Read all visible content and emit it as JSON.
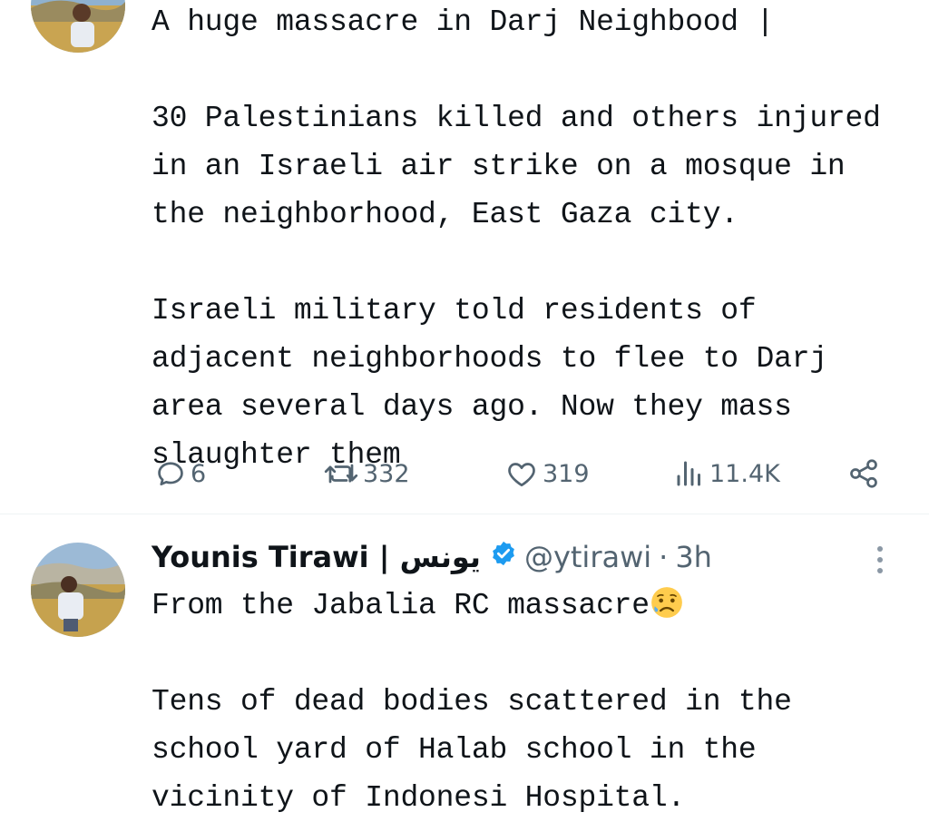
{
  "tweet1": {
    "text": "A huge massacre in Darj Neighbood |\n\n30 Palestinians killed and others injured in an Israeli air strike on a mosque in the neighborhood, East Gaza city.\n\nIsraeli military told residents of adjacent neighborhoods to flee to Darj area several days ago. Now they mass slaughter them",
    "actions": {
      "replies": "6",
      "reposts": "332",
      "likes": "319",
      "views": "11.4K"
    },
    "icons": [
      "reply-icon",
      "repost-icon",
      "like-icon",
      "views-icon",
      "share-icon"
    ]
  },
  "tweet2": {
    "display_name": "Younis Tirawi | يونس",
    "handle": "@ytirawi",
    "separator": "·",
    "time": "3h",
    "text_line1": "From the Jabalia RC massacre",
    "text_rest": "\n\nTens of dead bodies scattered in the school yard of Halab school in the vicinity of Indonesi Hospital.",
    "emoji": "sad-but-relieved-face",
    "verified": true
  },
  "colors": {
    "text": "#0f1419",
    "secondary": "#536471",
    "verified_blue": "#1d9bf0",
    "divider": "#eff3f4"
  }
}
